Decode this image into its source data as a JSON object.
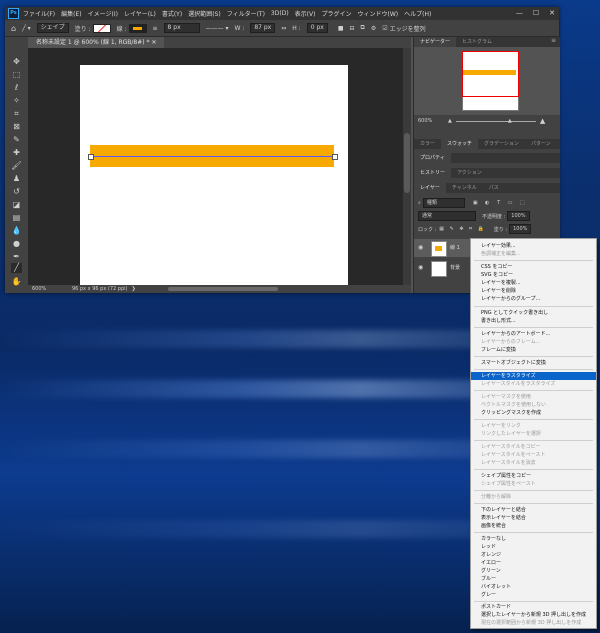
{
  "app": {
    "logo": "Ps",
    "menus": [
      "ファイル(F)",
      "編集(E)",
      "イメージ(I)",
      "レイヤー(L)",
      "書式(Y)",
      "選択範囲(S)",
      "フィルター(T)",
      "3D(D)",
      "表示(V)",
      "プラグイン",
      "ウィンドウ(W)",
      "ヘルプ(H)"
    ],
    "window_buttons": [
      "—",
      "☐",
      "✕"
    ]
  },
  "options": {
    "shape_mode": "シェイプ",
    "fill_label": "塗り :",
    "stroke_label": "線 :",
    "stroke_width": "8 px",
    "w_label": "W :",
    "w_value": "87 px",
    "h_label": "H :",
    "h_value": "0 px",
    "align_edges": "エッジを整列",
    "stroke_color": "#f7a900"
  },
  "document": {
    "tab_title": "名称未設定 1 @ 600% (線 1, RGB/8#) *",
    "zoom": "600%",
    "size_info": "96 px x 96 px (72 ppi)",
    "stroke_color": "#f7a900"
  },
  "panels": {
    "nav_tabs": [
      "ナビゲーター",
      "ヒストグラム"
    ],
    "nav_zoom": "600%",
    "color_tabs": [
      "カラー",
      "スウォッチ",
      "グラデーション",
      "パターン"
    ],
    "properties_tab": "プロパティ",
    "history_tabs": [
      "ヒストリー",
      "アクション"
    ],
    "layer_tabs": [
      "レイヤー",
      "チャンネル",
      "パス"
    ],
    "kind_label": "種類",
    "blend_mode": "通常",
    "opacity_label": "不透明度 :",
    "opacity_value": "100%",
    "lock_label": "ロック :",
    "fill_label": "塗り :",
    "fill_value": "100%",
    "layers": [
      {
        "name": "線 1"
      },
      {
        "name": "背景"
      }
    ]
  },
  "context_menu": {
    "items": [
      {
        "label": "レイヤー効果...",
        "enabled": true
      },
      {
        "label": "色調補正を編集...",
        "enabled": false
      },
      {
        "label": "CSS をコピー",
        "enabled": true
      },
      {
        "label": "SVG をコピー",
        "enabled": true
      },
      {
        "label": "レイヤーを複製...",
        "enabled": true
      },
      {
        "label": "レイヤーを削除",
        "enabled": true
      },
      {
        "label": "レイヤーからのグループ...",
        "enabled": true
      },
      {
        "label": "PNG としてクイック書き出し",
        "enabled": true
      },
      {
        "label": "書き出し形式...",
        "enabled": true
      },
      {
        "label": "レイヤーからのアートボード...",
        "enabled": true
      },
      {
        "label": "レイヤーからのフレーム...",
        "enabled": false
      },
      {
        "label": "フレームに変換",
        "enabled": true
      },
      {
        "label": "スマートオブジェクトに変換",
        "enabled": true
      },
      {
        "label": "レイヤーをラスタライズ",
        "enabled": true,
        "highlighted": true
      },
      {
        "label": "レイヤースタイルをラスタライズ",
        "enabled": false
      },
      {
        "label": "レイヤーマスクを使用",
        "enabled": false
      },
      {
        "label": "ベクトルマスクを使用しない",
        "enabled": false
      },
      {
        "label": "クリッピングマスクを作成",
        "enabled": true
      },
      {
        "label": "レイヤーをリンク",
        "enabled": false
      },
      {
        "label": "リンクしたレイヤーを選択",
        "enabled": false
      },
      {
        "label": "レイヤースタイルをコピー",
        "enabled": false
      },
      {
        "label": "レイヤースタイルをペースト",
        "enabled": false
      },
      {
        "label": "レイヤースタイルを消去",
        "enabled": false
      },
      {
        "label": "シェイプ属性をコピー",
        "enabled": true
      },
      {
        "label": "シェイプ属性をペースト",
        "enabled": false
      },
      {
        "label": "分離から解除",
        "enabled": false
      },
      {
        "label": "下のレイヤーと結合",
        "enabled": true
      },
      {
        "label": "表示レイヤーを結合",
        "enabled": true
      },
      {
        "label": "画像を統合",
        "enabled": true
      },
      {
        "label": "カラーなし",
        "enabled": true
      },
      {
        "label": "レッド",
        "enabled": true
      },
      {
        "label": "オレンジ",
        "enabled": true
      },
      {
        "label": "イエロー",
        "enabled": true
      },
      {
        "label": "グリーン",
        "enabled": true
      },
      {
        "label": "ブルー",
        "enabled": true
      },
      {
        "label": "バイオレット",
        "enabled": true
      },
      {
        "label": "グレー",
        "enabled": true
      },
      {
        "label": "ポストカード",
        "enabled": true
      },
      {
        "label": "選択したレイヤーから新規 3D 押し出しを作成",
        "enabled": true
      },
      {
        "label": "現在の選択範囲から新規 3D 押し出しを作成",
        "enabled": false
      }
    ]
  }
}
